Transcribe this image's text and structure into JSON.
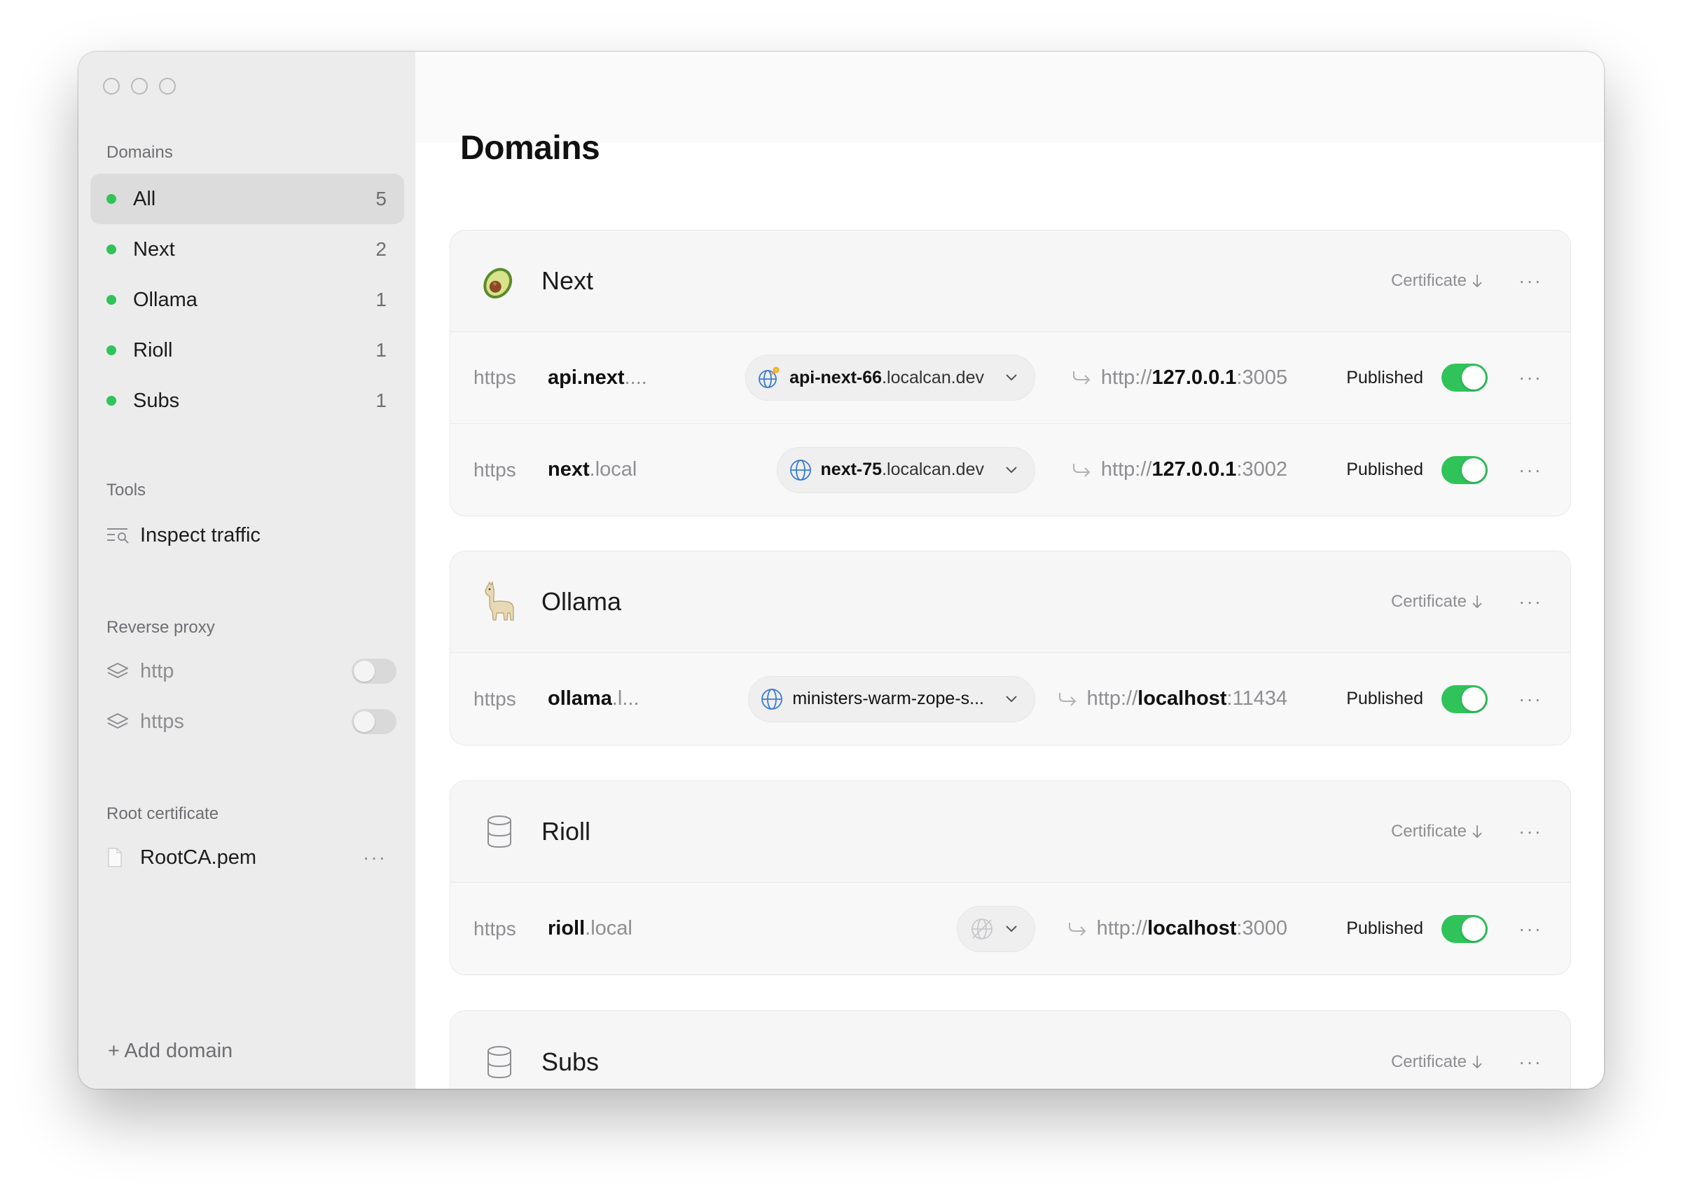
{
  "sidebar": {
    "domains_heading": "Domains",
    "domains": [
      {
        "label": "All",
        "count": "5",
        "color": "#30c35a"
      },
      {
        "label": "Next",
        "count": "2",
        "color": "#30c35a"
      },
      {
        "label": "Ollama",
        "count": "1",
        "color": "#30c35a"
      },
      {
        "label": "Rioll",
        "count": "1",
        "color": "#30c35a"
      },
      {
        "label": "Subs",
        "count": "1",
        "color": "#30c35a"
      }
    ],
    "tools_heading": "Tools",
    "inspect_traffic": "Inspect traffic",
    "reverse_proxy_heading": "Reverse proxy",
    "proxy_http": "http",
    "proxy_https": "https",
    "root_certificate_heading": "Root certificate",
    "root_cert_file": "RootCA.pem",
    "more": "···",
    "add_domain": "+ Add domain"
  },
  "main": {
    "title": "Domains",
    "certificate_label": "Certificate",
    "more": "···",
    "groups": [
      {
        "name": "Next",
        "icon": "avocado-icon",
        "rows": [
          {
            "protocol": "https",
            "host_bold": "api.next",
            "host_rest": "....",
            "tunnel_bold": "api-next-66",
            "tunnel_rest": ".localcan.dev",
            "target_scheme": "http://",
            "target_host": "127.0.0.1",
            "target_port": ":3005",
            "status": "Published"
          },
          {
            "protocol": "https",
            "host_bold": "next",
            "host_rest": ".local",
            "tunnel_bold": "next-75",
            "tunnel_rest": ".localcan.dev",
            "target_scheme": "http://",
            "target_host": "127.0.0.1",
            "target_port": ":3002",
            "status": "Published"
          }
        ]
      },
      {
        "name": "Ollama",
        "icon": "llama-icon",
        "rows": [
          {
            "protocol": "https",
            "host_bold": "ollama",
            "host_rest": ".l...",
            "tunnel_bold": "ministers-warm-zope-s...",
            "tunnel_rest": "",
            "target_scheme": "http://",
            "target_host": "localhost",
            "target_port": ":11434",
            "status": "Published"
          }
        ]
      },
      {
        "name": "Rioll",
        "icon": "database-icon",
        "rows": [
          {
            "protocol": "https",
            "host_bold": "rioll",
            "host_rest": ".local",
            "target_scheme": "http://",
            "target_host": "localhost",
            "target_port": ":3000",
            "status": "Published"
          }
        ]
      },
      {
        "name": "Subs",
        "icon": "database-icon",
        "rows": []
      }
    ]
  }
}
